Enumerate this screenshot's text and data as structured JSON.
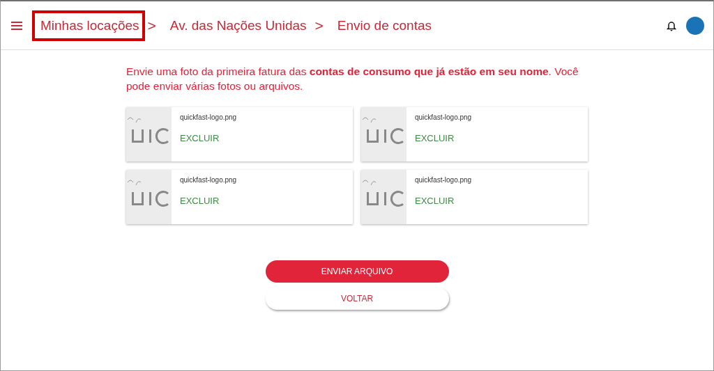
{
  "breadcrumb": [
    {
      "label": "Minhas locações",
      "highlighted": true
    },
    {
      "label": "Av. das Nações Unidas",
      "highlighted": false
    },
    {
      "label": "Envio de contas",
      "highlighted": false
    }
  ],
  "separator": ">",
  "instructions": "Envie uma foto da primeira fatura das **contas de consumo que já estão em seu nome**. Você pode enviar várias fotos ou arquivos.",
  "files": [
    {
      "name": "quickfast-logo.png",
      "action": "EXCLUIR"
    },
    {
      "name": "quickfast-logo.png",
      "action": "EXCLUIR"
    },
    {
      "name": "quickfast-logo.png",
      "action": "EXCLUIR"
    },
    {
      "name": "quickfast-logo.png",
      "action": "EXCLUIR"
    }
  ],
  "buttons": [
    {
      "label": "ENVIAR ARQUIVO",
      "kind": "primary"
    },
    {
      "label": "VOLTAR",
      "kind": "secondary"
    }
  ]
}
